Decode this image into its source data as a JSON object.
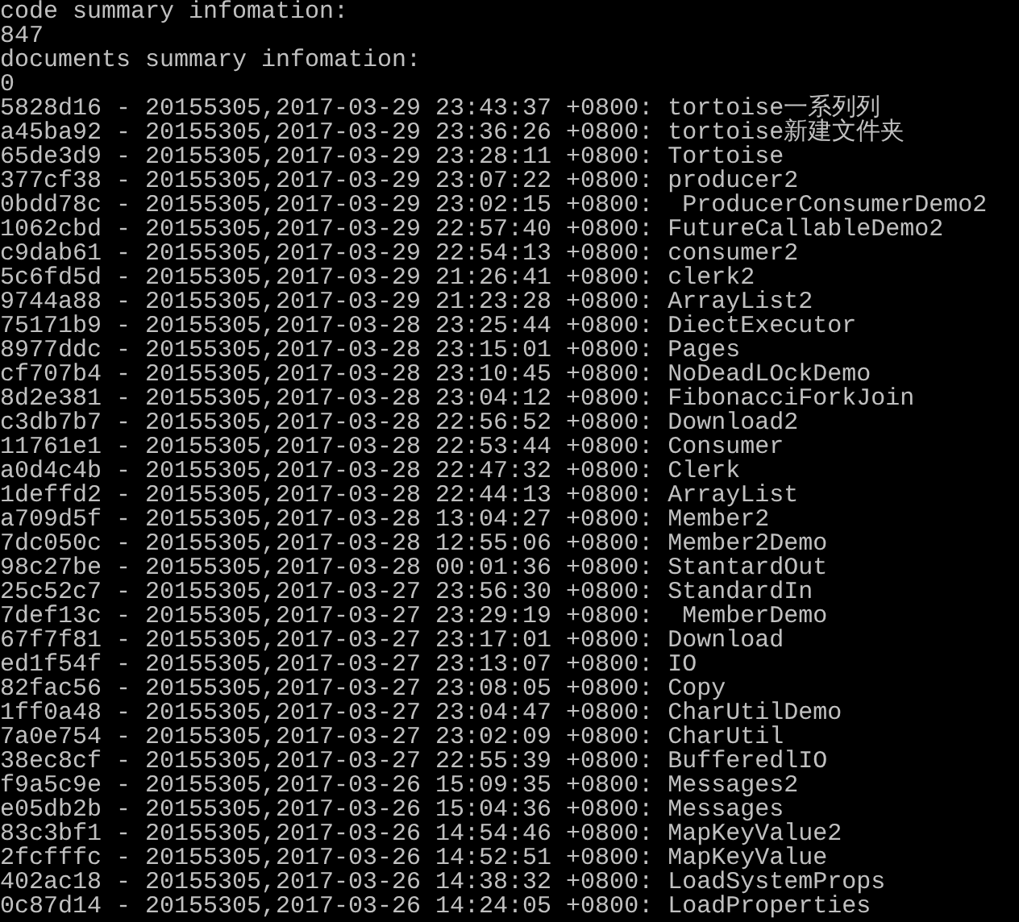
{
  "console_lines": [
    "code summary infomation:",
    "847",
    "documents summary infomation:",
    "0",
    "5828d16 - 20155305,2017-03-29 23:43:37 +0800: tortoise一系列列",
    "a45ba92 - 20155305,2017-03-29 23:36:26 +0800: tortoise新建文件夹",
    "65de3d9 - 20155305,2017-03-29 23:28:11 +0800: Tortoise",
    "377cf38 - 20155305,2017-03-29 23:07:22 +0800: producer2",
    "0bdd78c - 20155305,2017-03-29 23:02:15 +0800:  ProducerConsumerDemo2",
    "1062cbd - 20155305,2017-03-29 22:57:40 +0800: FutureCallableDemo2",
    "c9dab61 - 20155305,2017-03-29 22:54:13 +0800: consumer2",
    "5c6fd5d - 20155305,2017-03-29 21:26:41 +0800: clerk2",
    "9744a88 - 20155305,2017-03-29 21:23:28 +0800: ArrayList2",
    "75171b9 - 20155305,2017-03-28 23:25:44 +0800: DiectExecutor",
    "8977ddc - 20155305,2017-03-28 23:15:01 +0800: Pages",
    "cf707b4 - 20155305,2017-03-28 23:10:45 +0800: NoDeadLOckDemo",
    "8d2e381 - 20155305,2017-03-28 23:04:12 +0800: FibonacciForkJoin",
    "c3db7b7 - 20155305,2017-03-28 22:56:52 +0800: Download2",
    "11761e1 - 20155305,2017-03-28 22:53:44 +0800: Consumer",
    "a0d4c4b - 20155305,2017-03-28 22:47:32 +0800: Clerk",
    "1deffd2 - 20155305,2017-03-28 22:44:13 +0800: ArrayList",
    "a709d5f - 20155305,2017-03-28 13:04:27 +0800: Member2",
    "7dc050c - 20155305,2017-03-28 12:55:06 +0800: Member2Demo",
    "98c27be - 20155305,2017-03-28 00:01:36 +0800: StantardOut",
    "25c52c7 - 20155305,2017-03-27 23:56:30 +0800: StandardIn",
    "7def13c - 20155305,2017-03-27 23:29:19 +0800:  MemberDemo",
    "67f7f81 - 20155305,2017-03-27 23:17:01 +0800: Download",
    "ed1f54f - 20155305,2017-03-27 23:13:07 +0800: IO",
    "82fac56 - 20155305,2017-03-27 23:08:05 +0800: Copy",
    "1ff0a48 - 20155305,2017-03-27 23:04:47 +0800: CharUtilDemo",
    "7a0e754 - 20155305,2017-03-27 23:02:09 +0800: CharUtil",
    "38ec8cf - 20155305,2017-03-27 22:55:39 +0800: BufferedlIO",
    "f9a5c9e - 20155305,2017-03-26 15:09:35 +0800: Messages2",
    "e05db2b - 20155305,2017-03-26 15:04:36 +0800: Messages",
    "83c3bf1 - 20155305,2017-03-26 14:54:46 +0800: MapKeyValue2",
    "2fcfffc - 20155305,2017-03-26 14:52:51 +0800: MapKeyValue",
    "402ac18 - 20155305,2017-03-26 14:38:32 +0800: LoadSystemProps",
    "0c87d14 - 20155305,2017-03-26 14:24:05 +0800: LoadProperties"
  ]
}
